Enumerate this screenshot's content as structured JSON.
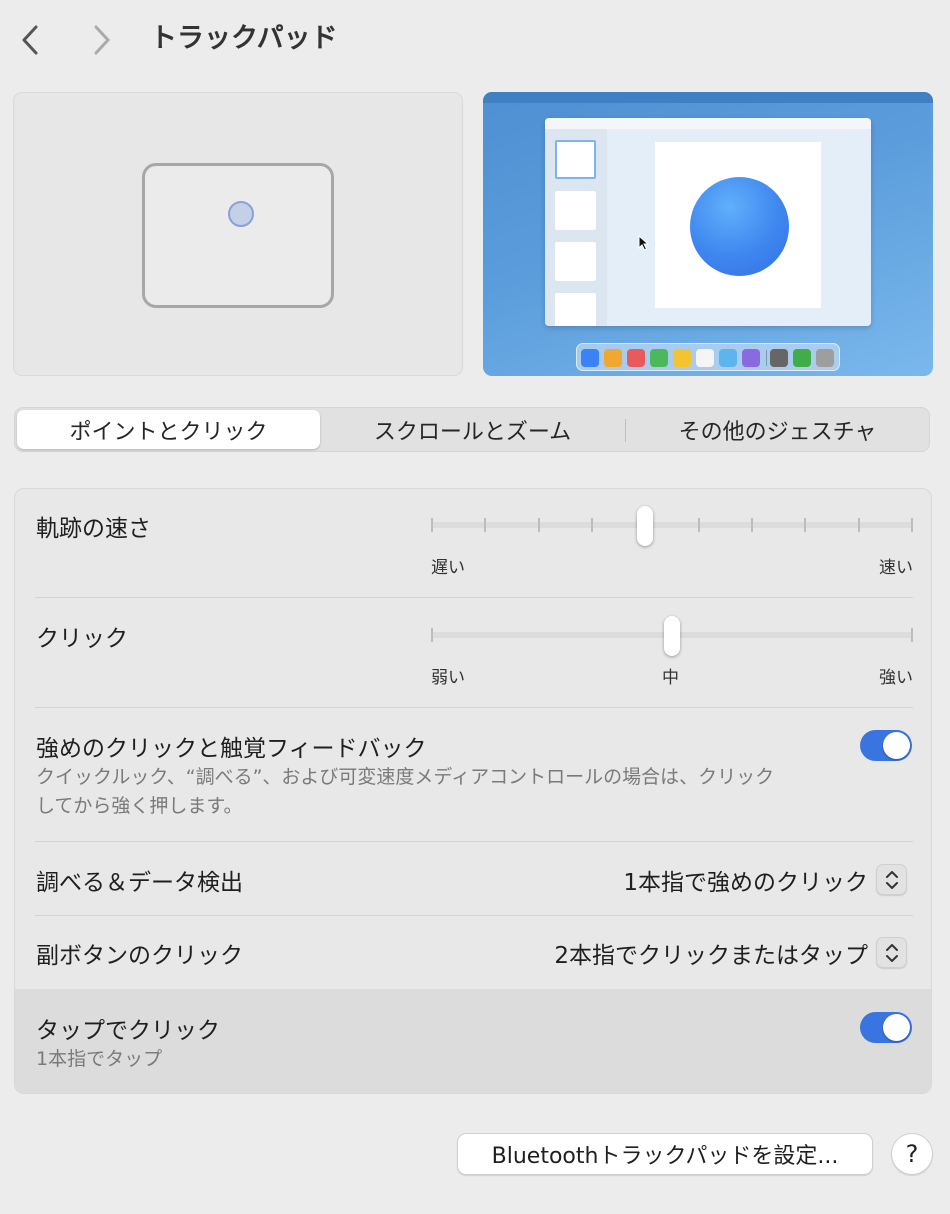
{
  "header": {
    "title": "トラックパッド",
    "back_icon": "chevron-left-icon",
    "forward_icon": "chevron-right-icon"
  },
  "colors": {
    "accent": "#3a74e0",
    "window_bg": "#ececec",
    "dock_icons": [
      "#3b82f6",
      "#f0a830",
      "#e95a5f",
      "#4cb85c",
      "#f4c430",
      "#f5f5f5",
      "#5db5f0",
      "#8a6ae0",
      "#666666",
      "#3fae49",
      "#9e9e9e"
    ]
  },
  "tabs": [
    {
      "label": "ポイントとクリック",
      "active": true
    },
    {
      "label": "スクロールとズーム",
      "active": false
    },
    {
      "label": "その他のジェスチャ",
      "active": false
    }
  ],
  "settings": {
    "tracking_speed": {
      "label": "軌跡の速さ",
      "min_label": "遅い",
      "max_label": "速い",
      "ticks": 10,
      "value_step": 4
    },
    "click": {
      "label": "クリック",
      "min_label": "弱い",
      "mid_label": "中",
      "max_label": "強い",
      "ticks": 3,
      "value_step": 1
    },
    "force_click": {
      "label": "強めのクリックと触覚フィードバック",
      "description_line1": "クイックルック、“調べる”、および可変速度メディアコントロールの場合は、クリック",
      "description_line2": "してから強く押します。",
      "enabled": true
    },
    "lookup": {
      "label": "調べる＆データ検出",
      "value": "1本指で強めのクリック"
    },
    "secondary_click": {
      "label": "副ボタンのクリック",
      "value": "2本指でクリックまたはタップ"
    },
    "tap_to_click": {
      "label": "タップでクリック",
      "description": "1本指でタップ",
      "enabled": true
    }
  },
  "footer": {
    "bluetooth_button": "Bluetoothトラックパッドを設定...",
    "help_button": "?"
  }
}
